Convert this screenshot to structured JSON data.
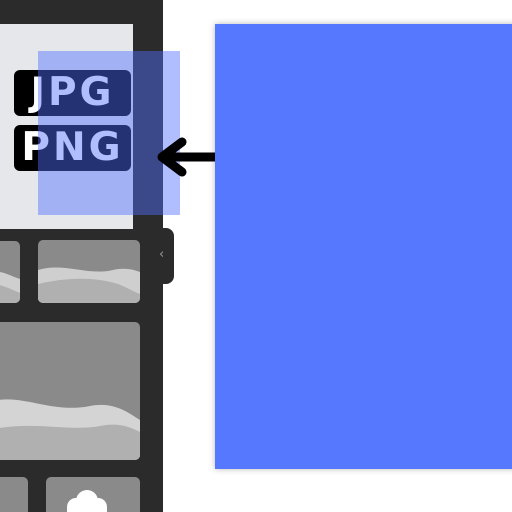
{
  "sidebar": {
    "preview": {
      "badges": [
        "JPG",
        "PNG"
      ]
    },
    "collapse_icon": "chevron-left-icon",
    "collapse_glyph": "‹"
  },
  "overlay": {
    "color": "#506eff"
  },
  "canvas": {
    "page_color": "#5578ff"
  },
  "colors": {
    "sidebar_bg": "#2b2b2b",
    "preview_bg": "#e5e7ea",
    "thumb_bg": "#8a8a8a",
    "badge_bg": "#000000"
  }
}
